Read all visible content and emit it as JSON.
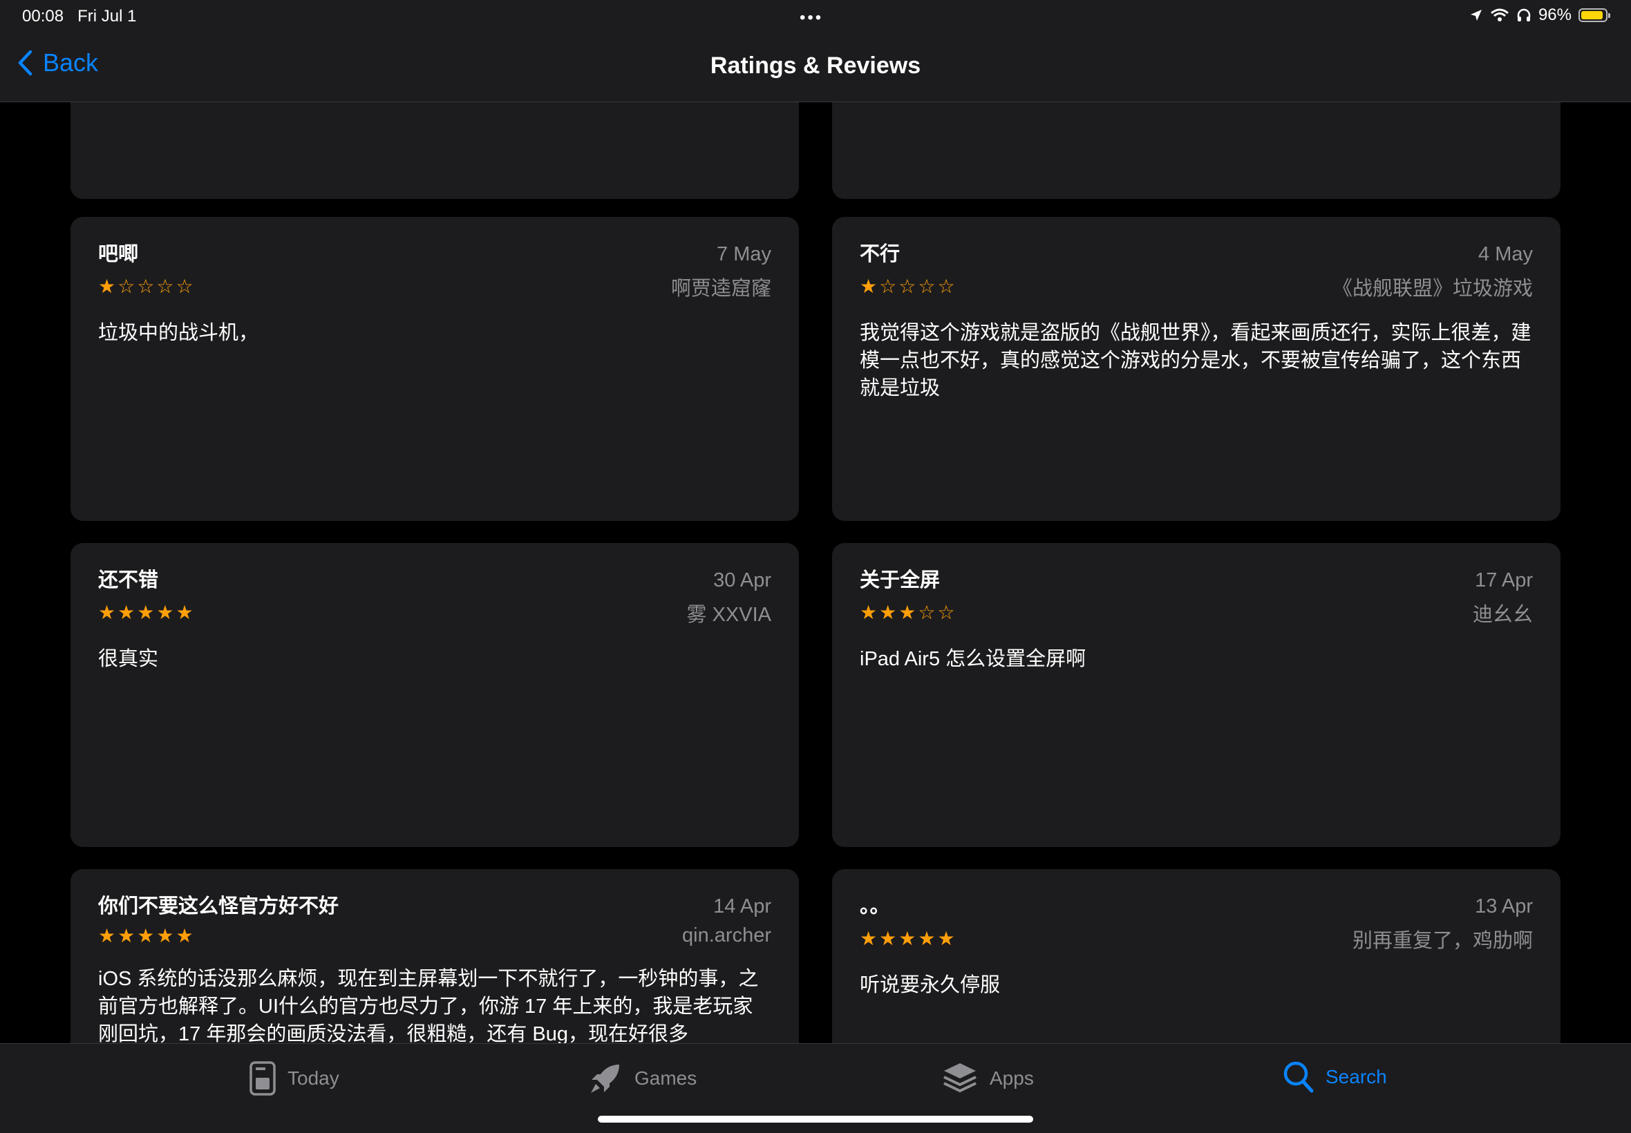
{
  "status": {
    "time": "00:08",
    "date": "Fri Jul 1",
    "battery": "96%"
  },
  "nav": {
    "back_label": "Back",
    "title": "Ratings & Reviews"
  },
  "reviews": [
    {
      "title": "吧唧",
      "date": "7 May",
      "author": "啊贾逵窟窿",
      "rating": 1,
      "body": "垃圾中的战斗机，"
    },
    {
      "title": "不行",
      "date": "4 May",
      "author": "《战舰联盟》垃圾游戏",
      "rating": 1,
      "body": "我觉得这个游戏就是盗版的《战舰世界》，看起来画质还行，实际上很差，建模一点也不好，真的感觉这个游戏的分是水，不要被宣传给骗了，这个东西就是垃圾"
    },
    {
      "title": "还不错",
      "date": "30 Apr",
      "author": "雾 XXVIA",
      "rating": 5,
      "body": "很真实"
    },
    {
      "title": "关于全屏",
      "date": "17 Apr",
      "author": "迪幺幺",
      "rating": 3,
      "body": "iPad Air5 怎么设置全屏啊"
    },
    {
      "title": "你们不要这么怪官方好不好",
      "date": "14 Apr",
      "author": "qin.archer",
      "rating": 5,
      "body": "iOS 系统的话没那么麻烦，现在到主屏幕划一下不就行了，一秒钟的事，之前官方也解释了。UI什么的官方也尽力了，你游 17 年上来的，我是老玩家刚回坑，17 年那会的画质没法看，很粗糙，还有 Bug，现在好很多"
    },
    {
      "title": "。。",
      "date": "13 Apr",
      "author": "别再重复了，鸡肋啊",
      "rating": 5,
      "body": "听说要永久停服"
    }
  ],
  "tabs": [
    {
      "label": "Today",
      "icon": "today-icon"
    },
    {
      "label": "Games",
      "icon": "rocket-icon"
    },
    {
      "label": "Apps",
      "icon": "apps-stack-icon"
    },
    {
      "label": "Search",
      "icon": "search-icon",
      "active": true
    }
  ],
  "colors": {
    "accent": "#0a84ff",
    "star": "#ff9f0a",
    "card": "#1c1c1e",
    "secondary_text": "#8e8e93"
  }
}
